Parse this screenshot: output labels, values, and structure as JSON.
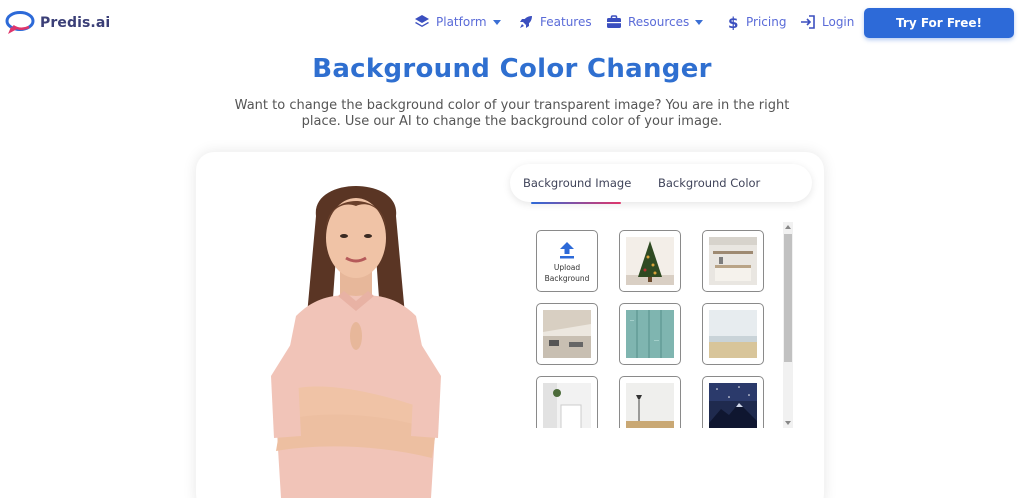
{
  "brand": {
    "name": "Predis.ai"
  },
  "nav": {
    "items": [
      {
        "label": "Platform",
        "icon": "layers-icon",
        "dropdown": true
      },
      {
        "label": "Features",
        "icon": "rocket-icon",
        "dropdown": false
      },
      {
        "label": "Resources",
        "icon": "briefcase-icon",
        "dropdown": true
      },
      {
        "label": "Pricing",
        "icon": "dollar-icon",
        "dropdown": false
      },
      {
        "label": "Login",
        "icon": "login-icon",
        "dropdown": false
      }
    ],
    "cta_label": "Try For Free!"
  },
  "hero": {
    "title": "Background Color Changer",
    "subtitle": "Want to change the background color of your transparent image? You are in the right place. Use our AI to change the background color of your image."
  },
  "editor": {
    "tabs": [
      {
        "label": "Background Image",
        "active": true
      },
      {
        "label": "Background Color",
        "active": false
      }
    ],
    "upload_label": "Upload Background",
    "backgrounds": [
      {
        "name": "christmas-tree-thumb"
      },
      {
        "name": "kitchen-thumb"
      },
      {
        "name": "office-thumb"
      },
      {
        "name": "teal-wood-thumb"
      },
      {
        "name": "beach-thumb"
      },
      {
        "name": "white-room-thumb"
      },
      {
        "name": "lamp-room-thumb"
      },
      {
        "name": "starry-mountain-thumb"
      }
    ]
  },
  "colors": {
    "accent": "#2d6ad8",
    "title": "#2f6fd0",
    "nav_text": "#5a6bd8",
    "underline_end": "#e0356a"
  }
}
